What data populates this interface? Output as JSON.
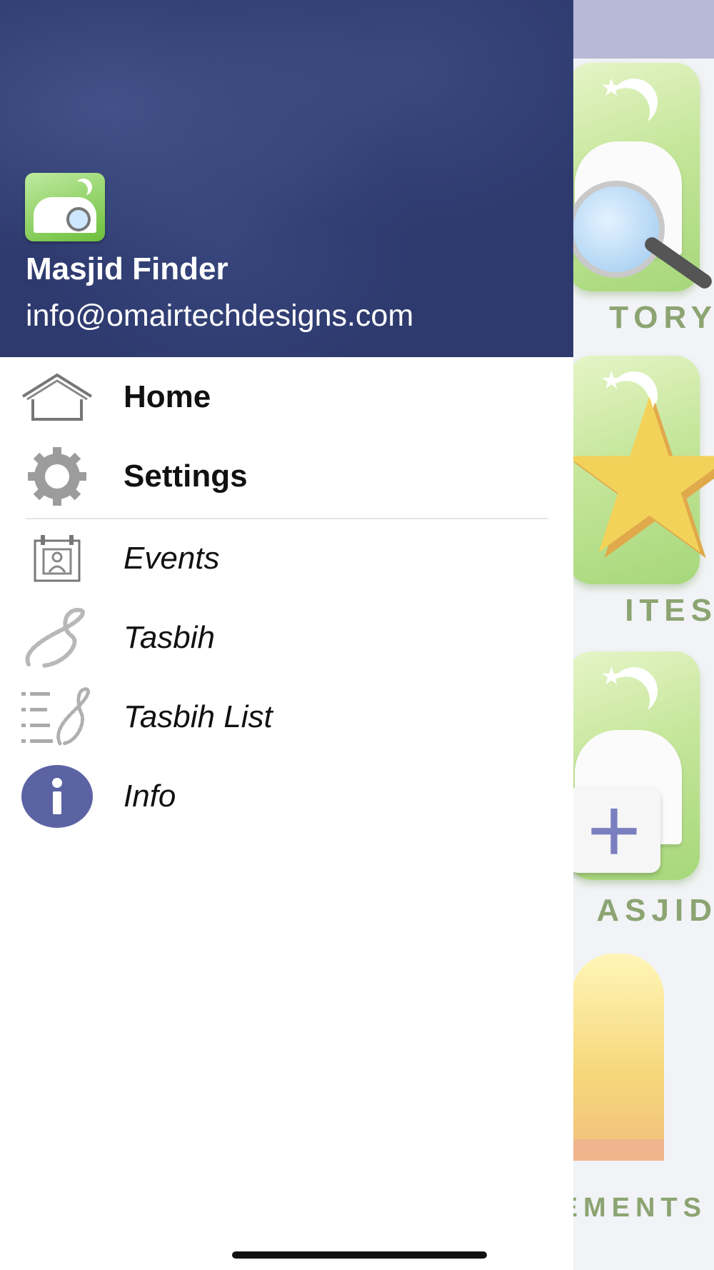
{
  "drawer": {
    "app_name": "Masjid Finder",
    "email": "info@omairtechdesigns.com",
    "menu": [
      {
        "label": "Home",
        "icon": "home-icon",
        "style": "bold"
      },
      {
        "label": "Settings",
        "icon": "gear-icon",
        "style": "bold"
      },
      {
        "label": "Events",
        "icon": "calendar-icon",
        "style": "italic"
      },
      {
        "label": "Tasbih",
        "icon": "prayer-beads-icon",
        "style": "italic"
      },
      {
        "label": "Tasbih List",
        "icon": "tasbih-list-icon",
        "style": "italic"
      },
      {
        "label": "Info",
        "icon": "info-icon",
        "style": "italic"
      }
    ]
  },
  "background_tiles": {
    "tile1_label": "TORY",
    "tile2_label": "ITES",
    "tile3_label": "ASJID",
    "tile4_label": "EMENTS"
  },
  "colors": {
    "header": "#2e3a6e",
    "info_icon": "#5b63a3",
    "topbar": "#b7b9d6"
  }
}
